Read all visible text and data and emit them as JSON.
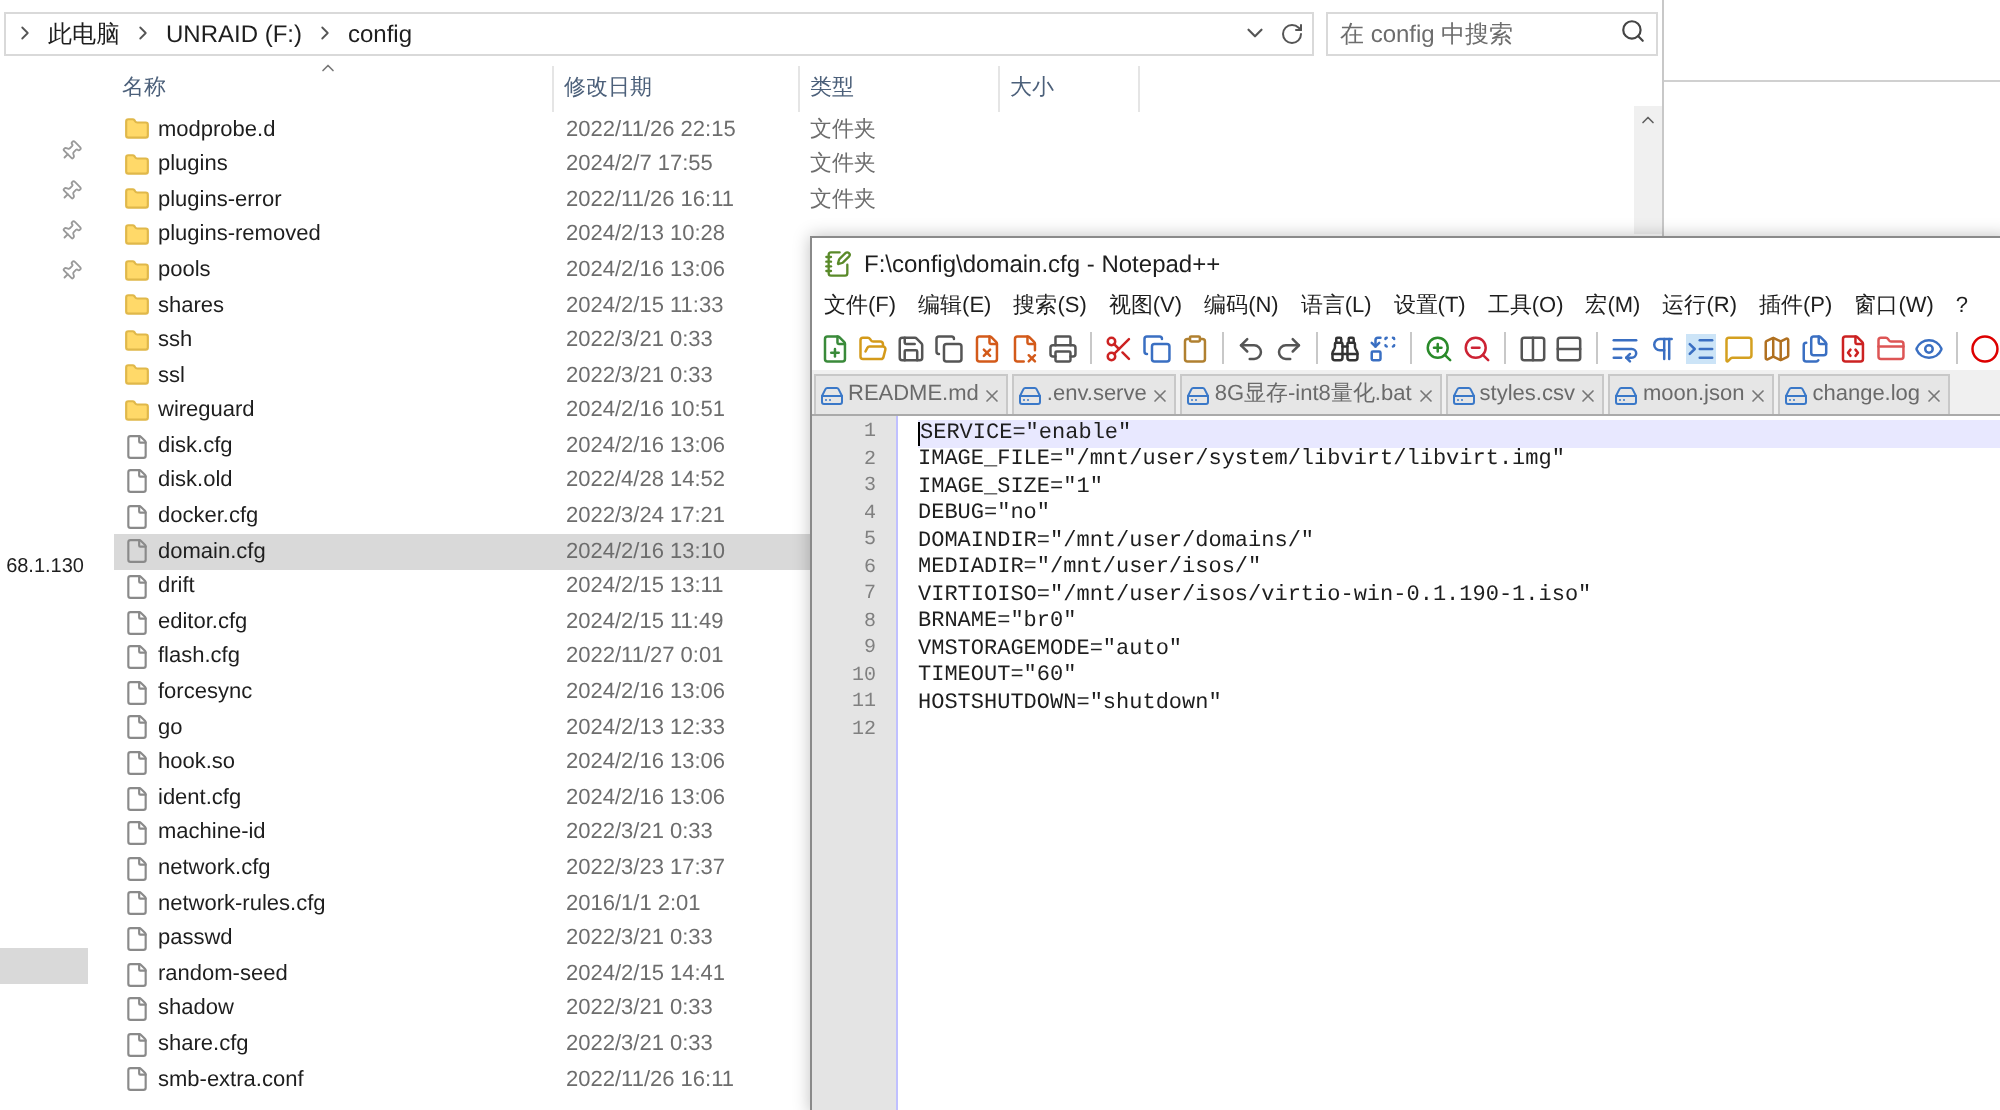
{
  "explorer": {
    "breadcrumbs": [
      "此电脑",
      "UNRAID (F:)",
      "config"
    ],
    "search": {
      "placeholder": "在 config 中搜索"
    },
    "nav": {
      "label": "68.1.130"
    },
    "columns": [
      "名称",
      "修改日期",
      "类型",
      "大小"
    ],
    "files": [
      {
        "kind": "folder",
        "name": "modprobe.d",
        "date": "2022/11/26 22:15",
        "type": "文件夹",
        "selected": false
      },
      {
        "kind": "folder",
        "name": "plugins",
        "date": "2024/2/7 17:55",
        "type": "文件夹",
        "selected": false
      },
      {
        "kind": "folder",
        "name": "plugins-error",
        "date": "2022/11/26 16:11",
        "type": "文件夹",
        "selected": false
      },
      {
        "kind": "folder",
        "name": "plugins-removed",
        "date": "2024/2/13 10:28",
        "selected": false
      },
      {
        "kind": "folder",
        "name": "pools",
        "date": "2024/2/16 13:06",
        "selected": false
      },
      {
        "kind": "folder",
        "name": "shares",
        "date": "2024/2/15 11:33",
        "selected": false
      },
      {
        "kind": "folder",
        "name": "ssh",
        "date": "2022/3/21 0:33",
        "selected": false
      },
      {
        "kind": "folder",
        "name": "ssl",
        "date": "2022/3/21 0:33",
        "selected": false
      },
      {
        "kind": "folder",
        "name": "wireguard",
        "date": "2024/2/16 10:51",
        "selected": false
      },
      {
        "kind": "file",
        "name": "disk.cfg",
        "date": "2024/2/16 13:06",
        "selected": false
      },
      {
        "kind": "file",
        "name": "disk.old",
        "date": "2022/4/28 14:52",
        "selected": false
      },
      {
        "kind": "file",
        "name": "docker.cfg",
        "date": "2022/3/24 17:21",
        "selected": false
      },
      {
        "kind": "file",
        "name": "domain.cfg",
        "date": "2024/2/16 13:10",
        "selected": true
      },
      {
        "kind": "file",
        "name": "drift",
        "date": "2024/2/15 13:11",
        "selected": false
      },
      {
        "kind": "file",
        "name": "editor.cfg",
        "date": "2024/2/15 11:49",
        "selected": false
      },
      {
        "kind": "file",
        "name": "flash.cfg",
        "date": "2022/11/27 0:01",
        "selected": false
      },
      {
        "kind": "file",
        "name": "forcesync",
        "date": "2024/2/16 13:06",
        "selected": false
      },
      {
        "kind": "file",
        "name": "go",
        "date": "2024/2/13 12:33",
        "selected": false
      },
      {
        "kind": "file",
        "name": "hook.so",
        "date": "2024/2/16 13:06",
        "selected": false
      },
      {
        "kind": "file",
        "name": "ident.cfg",
        "date": "2024/2/16 13:06",
        "selected": false
      },
      {
        "kind": "file",
        "name": "machine-id",
        "date": "2022/3/21 0:33",
        "selected": false
      },
      {
        "kind": "file",
        "name": "network.cfg",
        "date": "2022/3/23 17:37",
        "selected": false
      },
      {
        "kind": "file",
        "name": "network-rules.cfg",
        "date": "2016/1/1 2:01",
        "selected": false
      },
      {
        "kind": "file",
        "name": "passwd",
        "date": "2022/3/21 0:33",
        "selected": false
      },
      {
        "kind": "file",
        "name": "random-seed",
        "date": "2024/2/15 14:41",
        "selected": false
      },
      {
        "kind": "file",
        "name": "shadow",
        "date": "2022/3/21 0:33",
        "selected": false
      },
      {
        "kind": "file",
        "name": "share.cfg",
        "date": "2022/3/21 0:33",
        "selected": false
      },
      {
        "kind": "file",
        "name": "smb-extra.conf",
        "date": "2022/11/26 16:11",
        "selected": false
      }
    ]
  },
  "notepad": {
    "title": "F:\\config\\domain.cfg - Notepad++",
    "menu": [
      "文件(F)",
      "编辑(E)",
      "搜索(S)",
      "视图(V)",
      "编码(N)",
      "语言(L)",
      "设置(T)",
      "工具(O)",
      "宏(M)",
      "运行(R)",
      "插件(P)",
      "窗口(W)",
      "?"
    ],
    "tabs": [
      {
        "label": "README.md",
        "selected": false
      },
      {
        "label": ".env.serve",
        "selected": false
      },
      {
        "label": "8G显存-int8量化.bat",
        "selected": false
      },
      {
        "label": "styles.csv",
        "selected": false
      },
      {
        "label": "moon.json",
        "selected": false
      },
      {
        "label": "change.log",
        "selected": false
      }
    ],
    "lines": [
      {
        "number": "1",
        "text": "SERVICE=\"enable\"",
        "current": true
      },
      {
        "number": "2",
        "text": "IMAGE_FILE=\"/mnt/user/system/libvirt/libvirt.img\"",
        "current": false
      },
      {
        "number": "3",
        "text": "IMAGE_SIZE=\"1\"",
        "current": false
      },
      {
        "number": "4",
        "text": "DEBUG=\"no\"",
        "current": false
      },
      {
        "number": "5",
        "text": "DOMAINDIR=\"/mnt/user/domains/\"",
        "current": false
      },
      {
        "number": "6",
        "text": "MEDIADIR=\"/mnt/user/isos/\"",
        "current": false
      },
      {
        "number": "7",
        "text": "VIRTIOISO=\"/mnt/user/isos/virtio-win-0.1.190-1.iso\"",
        "current": false
      },
      {
        "number": "8",
        "text": "BRNAME=\"br0\"",
        "current": false
      },
      {
        "number": "9",
        "text": "VMSTORAGEMODE=\"auto\"",
        "current": false
      },
      {
        "number": "10",
        "text": "TIMEOUT=\"60\"",
        "current": false
      },
      {
        "number": "11",
        "text": "HOSTSHUTDOWN=\"shutdown\"",
        "current": false
      },
      {
        "number": "12",
        "current": false
      }
    ]
  }
}
